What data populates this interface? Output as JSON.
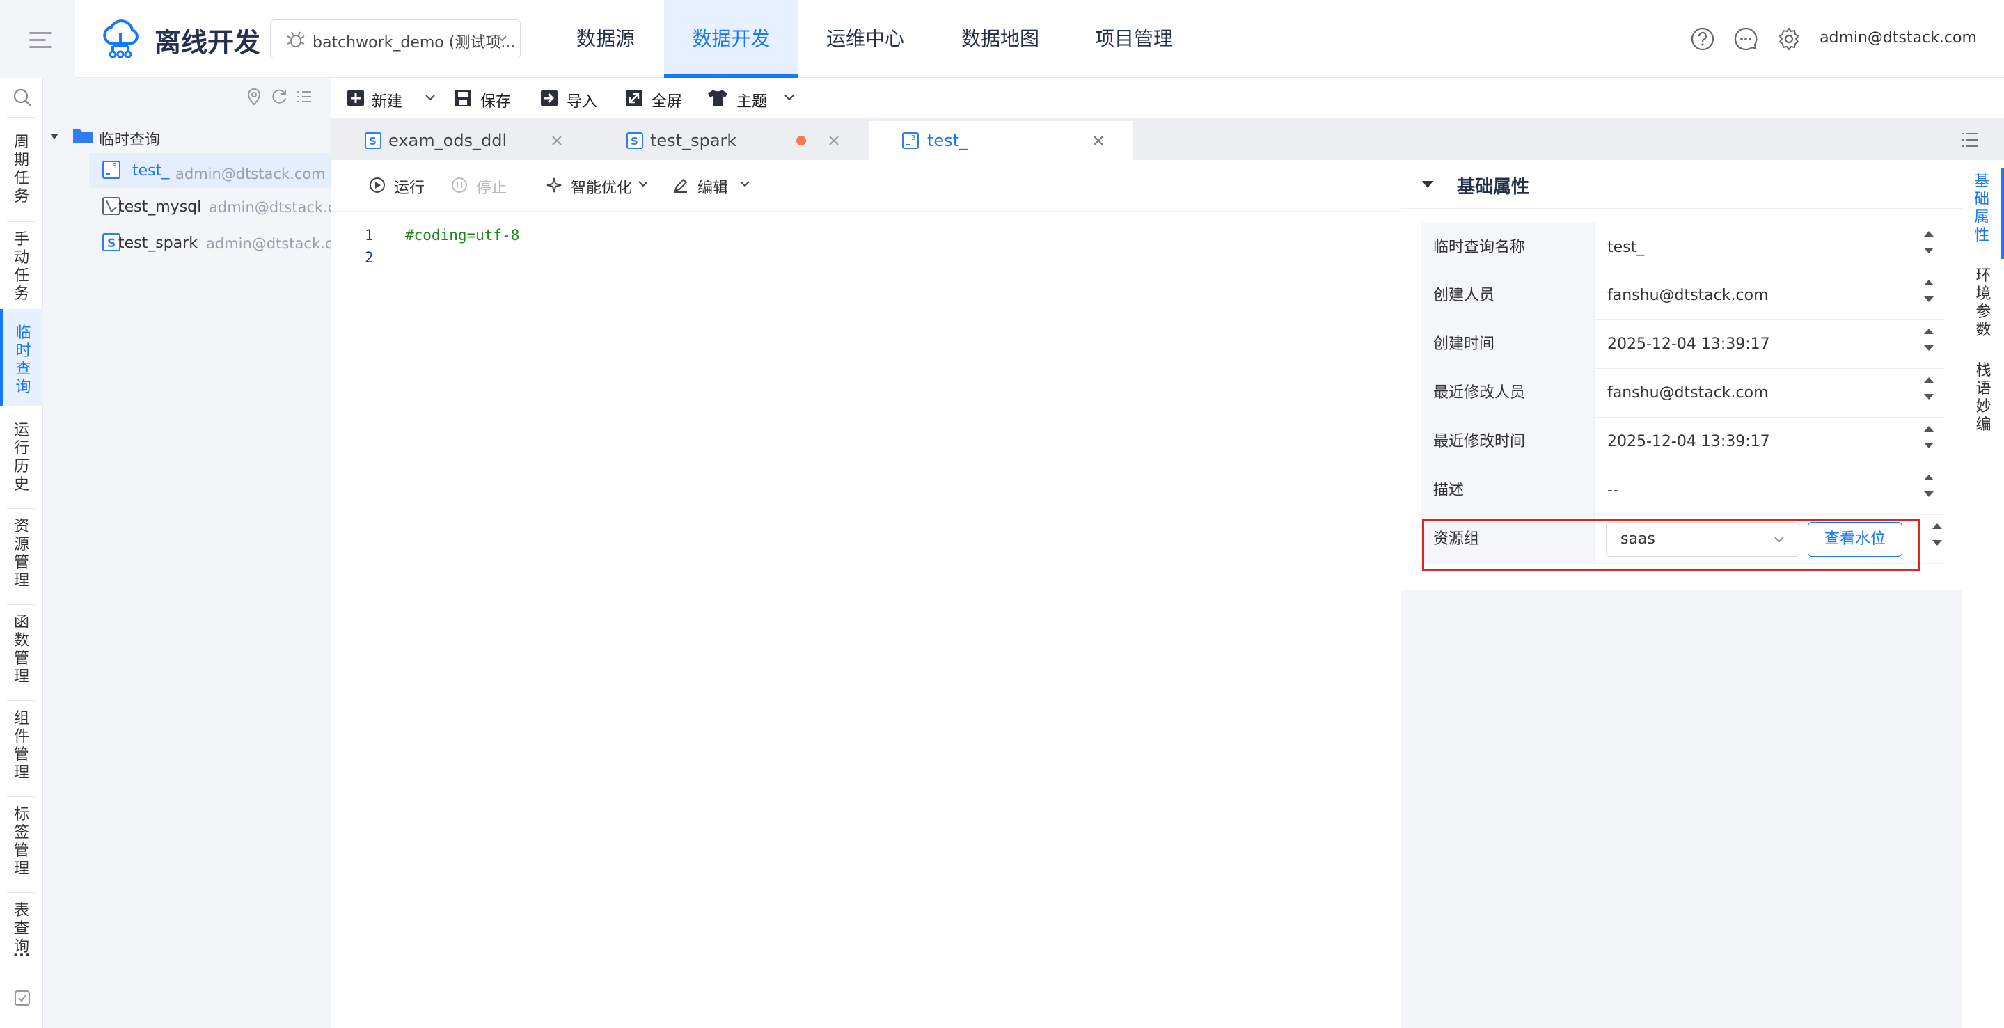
{
  "header": {
    "brand_title": "离线开发",
    "project_select": "batchwork_demo (测试项...",
    "nav_tabs": [
      "数据源",
      "数据开发",
      "运维中心",
      "数据地图",
      "项目管理"
    ],
    "active_nav": "数据开发",
    "user_email": "admin@dtstack.com"
  },
  "left_rail": {
    "items": [
      "周期任务",
      "手动任务",
      "临时查询",
      "运行历史",
      "资源管理",
      "函数管理",
      "组件管理",
      "标签管理",
      "表查询"
    ],
    "active": "临时查询",
    "more": "···"
  },
  "tree": {
    "folder": "临时查询",
    "files": [
      {
        "name": "test_",
        "owner": "admin@dtstack.com 锁...",
        "type": "python"
      },
      {
        "name": "test_mysql",
        "owner": "admin@dtstack.c...",
        "type": "sql"
      },
      {
        "name": "test_spark",
        "owner": "admin@dtstack.co...",
        "type": "spark"
      }
    ]
  },
  "toolbar": {
    "new_label": "新建",
    "save_label": "保存",
    "import_label": "导入",
    "fullscreen_label": "全屏",
    "theme_label": "主题"
  },
  "tabs": [
    {
      "name": "exam_ods_ddl",
      "modified": false,
      "active": false
    },
    {
      "name": "test_spark",
      "modified": true,
      "active": false
    },
    {
      "name": "test_",
      "modified": false,
      "active": true
    }
  ],
  "editor_toolbar": {
    "run_label": "运行",
    "stop_label": "停止",
    "optimize_label": "智能优化",
    "edit_label": "编辑"
  },
  "editor": {
    "lines": [
      "#coding=utf-8",
      ""
    ],
    "line_numbers": [
      "1",
      "2"
    ]
  },
  "props": {
    "title": "基础属性",
    "rows": [
      {
        "key": "临时查询名称",
        "value": "test_"
      },
      {
        "key": "创建人员",
        "value": "fanshu@dtstack.com"
      },
      {
        "key": "创建时间",
        "value": "2025-12-04 13:39:17"
      },
      {
        "key": "最近修改人员",
        "value": "fanshu@dtstack.com"
      },
      {
        "key": "最近修改时间",
        "value": "2025-12-04 13:39:17"
      },
      {
        "key": "描述",
        "value": "--"
      }
    ],
    "resource_group": {
      "key": "资源组",
      "value": "saas",
      "button": "查看水位"
    }
  },
  "right_rail": {
    "items": [
      "基础属性",
      "环境参数",
      "栈语妙编"
    ],
    "active": "基础属性"
  },
  "colors": {
    "accent": "#1677ff",
    "highlight_box": "#e02424",
    "modified_dot": "#f07b55"
  }
}
